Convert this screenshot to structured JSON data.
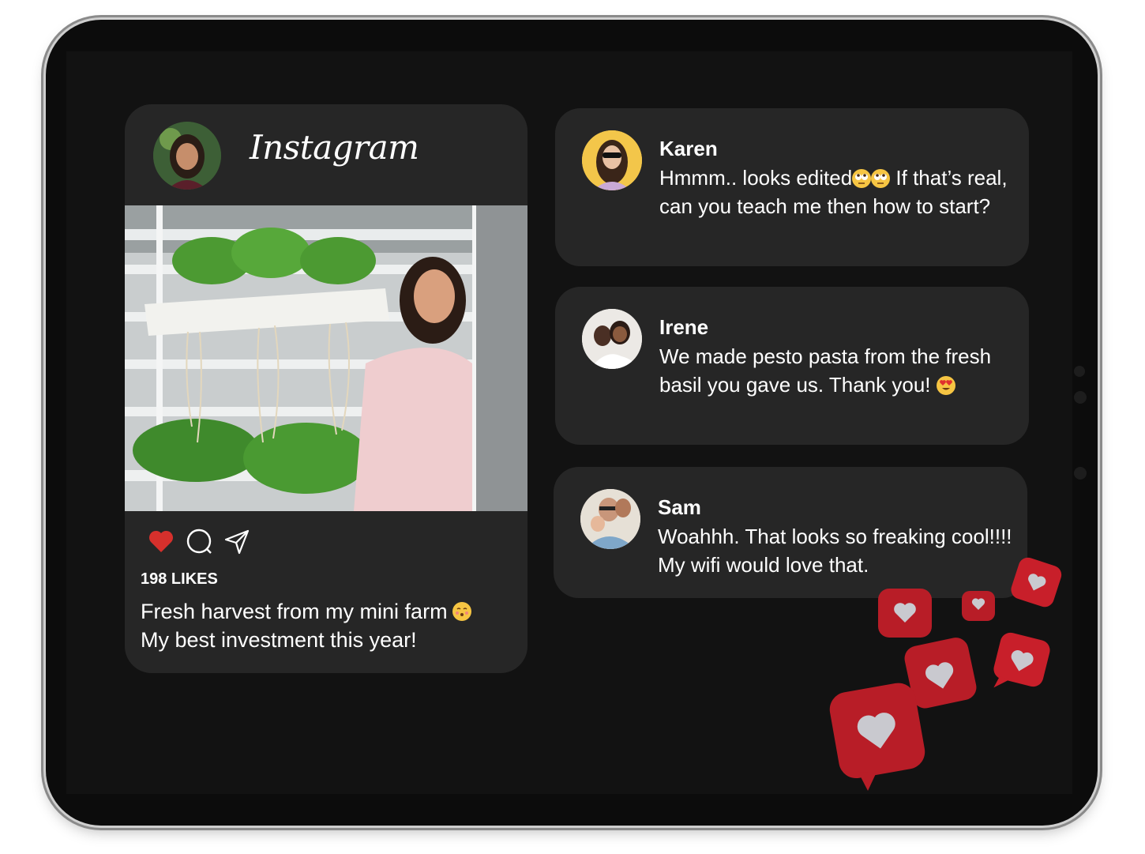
{
  "app": {
    "name": "Instagram"
  },
  "post": {
    "likes": "198 LIKES",
    "caption_line1": "Fresh harvest from my mini farm",
    "caption_line2": "My best investment this year!",
    "caption_emoji": "kissing-face-emoji"
  },
  "comments": [
    {
      "name": "Karen",
      "avatar_bg": "#f3c64a",
      "text_before": "Hmmm.. looks edited",
      "text_after": " If that’s real, can you teach me then how to start?",
      "emoji": "rolling-eyes-emoji"
    },
    {
      "name": "Irene",
      "avatar_bg": "#e9e6e2",
      "text_before": "We made pesto pasta from the fresh basil you gave us. Thank you!",
      "emoji": "heart-eyes-emoji"
    },
    {
      "name": "Sam",
      "avatar_bg": "#e7e1d7",
      "text_before": "Woahhh. That looks so freaking cool!!!! My wifi would love that."
    }
  ],
  "colors": {
    "card": "#262626",
    "screen": "#121212",
    "like_red": "#d6302c",
    "reaction_red": "#c81f2a"
  }
}
